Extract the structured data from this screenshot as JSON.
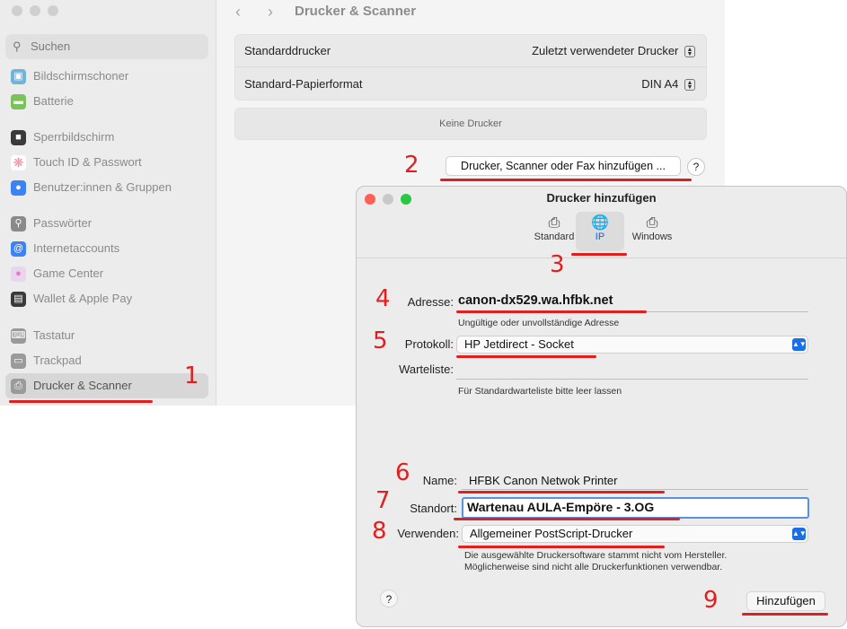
{
  "sidebar": {
    "search_placeholder": "Suchen",
    "items": [
      {
        "label": "Bildschirmschoner",
        "icon": "screensaver-icon",
        "color": "#6fb5d9"
      },
      {
        "label": "Batterie",
        "icon": "battery-icon",
        "color": "#7ac35b"
      },
      {
        "label": "Sperrbildschirm",
        "icon": "lock-icon",
        "color": "#3a3a3a"
      },
      {
        "label": "Touch ID & Passwort",
        "icon": "fingerprint-icon",
        "color": "#f08ba0"
      },
      {
        "label": "Benutzer:innen & Gruppen",
        "icon": "users-icon",
        "color": "#3b82f6"
      },
      {
        "label": "Passwörter",
        "icon": "key-icon",
        "color": "#8a8a8a"
      },
      {
        "label": "Internetaccounts",
        "icon": "at-icon",
        "color": "#3b82f6"
      },
      {
        "label": "Game Center",
        "icon": "game-center-icon",
        "color": "#e27bd0"
      },
      {
        "label": "Wallet & Apple Pay",
        "icon": "wallet-icon",
        "color": "#3a3a3a"
      },
      {
        "label": "Tastatur",
        "icon": "keyboard-icon",
        "color": "#9a9a9a"
      },
      {
        "label": "Trackpad",
        "icon": "trackpad-icon",
        "color": "#9a9a9a"
      },
      {
        "label": "Drucker & Scanner",
        "icon": "printer-icon",
        "color": "#9a9a9a"
      }
    ]
  },
  "main": {
    "title": "Drucker & Scanner",
    "default_printer_label": "Standarddrucker",
    "default_printer_value": "Zuletzt verwendeter Drucker",
    "paper_label": "Standard-Papierformat",
    "paper_value": "DIN A4",
    "no_printers": "Keine Drucker",
    "add_button": "Drucker, Scanner oder Fax hinzufügen ...",
    "help": "?"
  },
  "dialog": {
    "title": "Drucker hinzufügen",
    "tabs": [
      {
        "label": "Standard",
        "icon": "printer-icon"
      },
      {
        "label": "IP",
        "icon": "globe-icon"
      },
      {
        "label": "Windows",
        "icon": "windows-printer-icon"
      }
    ],
    "address_label": "Adresse:",
    "address_value": "canon-dx529.wa.hfbk.net",
    "address_note": "Ungültige oder unvollständige Adresse",
    "protocol_label": "Protokoll:",
    "protocol_value": "HP Jetdirect - Socket",
    "queue_label": "Warteliste:",
    "queue_value": "",
    "queue_note": "Für Standardwarteliste bitte leer lassen",
    "name_label": "Name:",
    "name_value": "HFBK Canon Netwok Printer",
    "location_label": "Standort:",
    "location_value": "Wartenau AULA-Empöre - 3.OG",
    "use_label": "Verwenden:",
    "use_value": "Allgemeiner PostScript-Drucker",
    "use_note_1": "Die ausgewählte Druckersoftware stammt nicht vom Hersteller.",
    "use_note_2": "Möglicherweise sind nicht alle Druckerfunktionen verwendbar.",
    "help": "?",
    "add_button": "Hinzufügen"
  },
  "annotations": {
    "n1": "1",
    "n2": "2",
    "n3": "3",
    "n4": "4",
    "n5": "5",
    "n6": "6",
    "n7": "7",
    "n8": "8",
    "n9": "9",
    "color": "#e0201e"
  }
}
